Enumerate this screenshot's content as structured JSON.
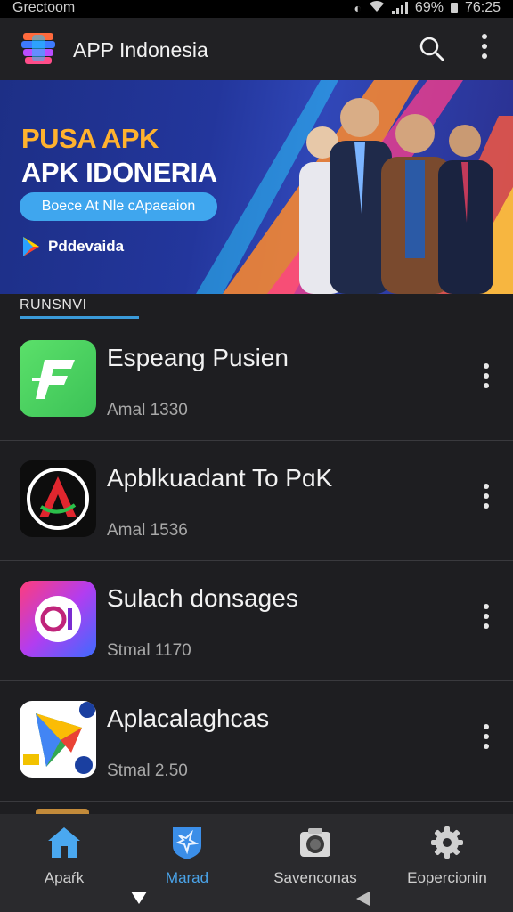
{
  "status_bar": {
    "carrier": "Grectoom",
    "battery": "69%",
    "time": "76:25"
  },
  "app_bar": {
    "title": "APP Indonesia",
    "icons": [
      "app-logo",
      "search-icon",
      "more-vert-icon"
    ]
  },
  "banner": {
    "headline_1": "PUSA APK",
    "headline_2": "APK IDONERIA",
    "pill_text": "Boece At Nle cApaeaion",
    "store_label": "Pddevaida",
    "colors": {
      "accent": "#ffb22e",
      "pill": "#3fa6ee"
    }
  },
  "section": {
    "label": "RUNSNVI"
  },
  "apps": [
    {
      "name": "Espeang Pusien",
      "meta": "Amal 1330",
      "icon": "green-f-icon"
    },
    {
      "name": "Apblkuadant To PɑK",
      "meta": "Amal 1536",
      "icon": "red-a-circle-icon"
    },
    {
      "name": "Sulach donsages",
      "meta": "Stmal 1170",
      "icon": "gradient-ci-icon"
    },
    {
      "name": "Aplacalaghcas",
      "meta": "Stmal 2.50",
      "icon": "play-triangle-icon"
    }
  ],
  "bottom_nav": {
    "items": [
      {
        "label": "Apaŕk",
        "icon": "home-icon",
        "active": false
      },
      {
        "label": "Marad",
        "icon": "shield-icon",
        "active": true
      },
      {
        "label": "Savenconas",
        "icon": "camera-icon",
        "active": false
      },
      {
        "label": "Eopercionin",
        "icon": "gear-icon",
        "active": false
      }
    ]
  }
}
